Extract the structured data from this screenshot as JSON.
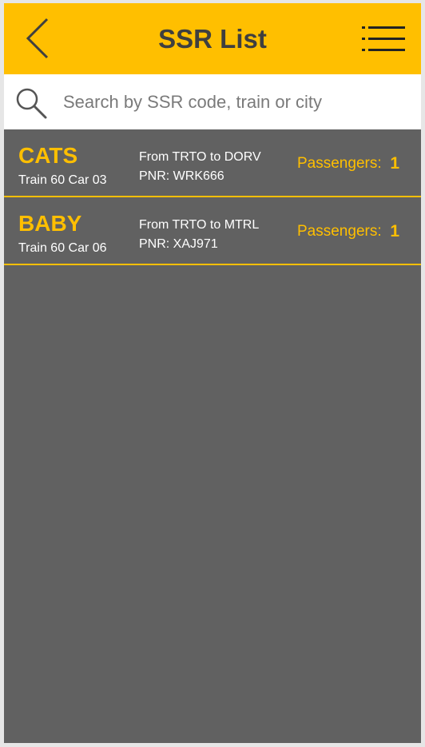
{
  "header": {
    "title": "SSR List",
    "back_icon": "chevron-left-icon",
    "menu_icon": "list-menu-icon"
  },
  "search": {
    "placeholder": "Search by SSR code, train or city",
    "value": "",
    "icon": "search-icon"
  },
  "colors": {
    "accent": "#ffbf00",
    "list_background": "#616161",
    "header_text": "#3f3f3f",
    "row_text": "#ffffff"
  },
  "ssr_items": [
    {
      "code": "CATS",
      "train": "Train 60 Car 03",
      "route": "From TRTO to DORV",
      "pnr": "PNR: WRK666",
      "passengers_label": "Passengers:",
      "passengers": "1"
    },
    {
      "code": "BABY",
      "train": "Train 60 Car 06",
      "route": "From TRTO to MTRL",
      "pnr": "PNR: XAJ971",
      "passengers_label": "Passengers:",
      "passengers": "1"
    }
  ]
}
